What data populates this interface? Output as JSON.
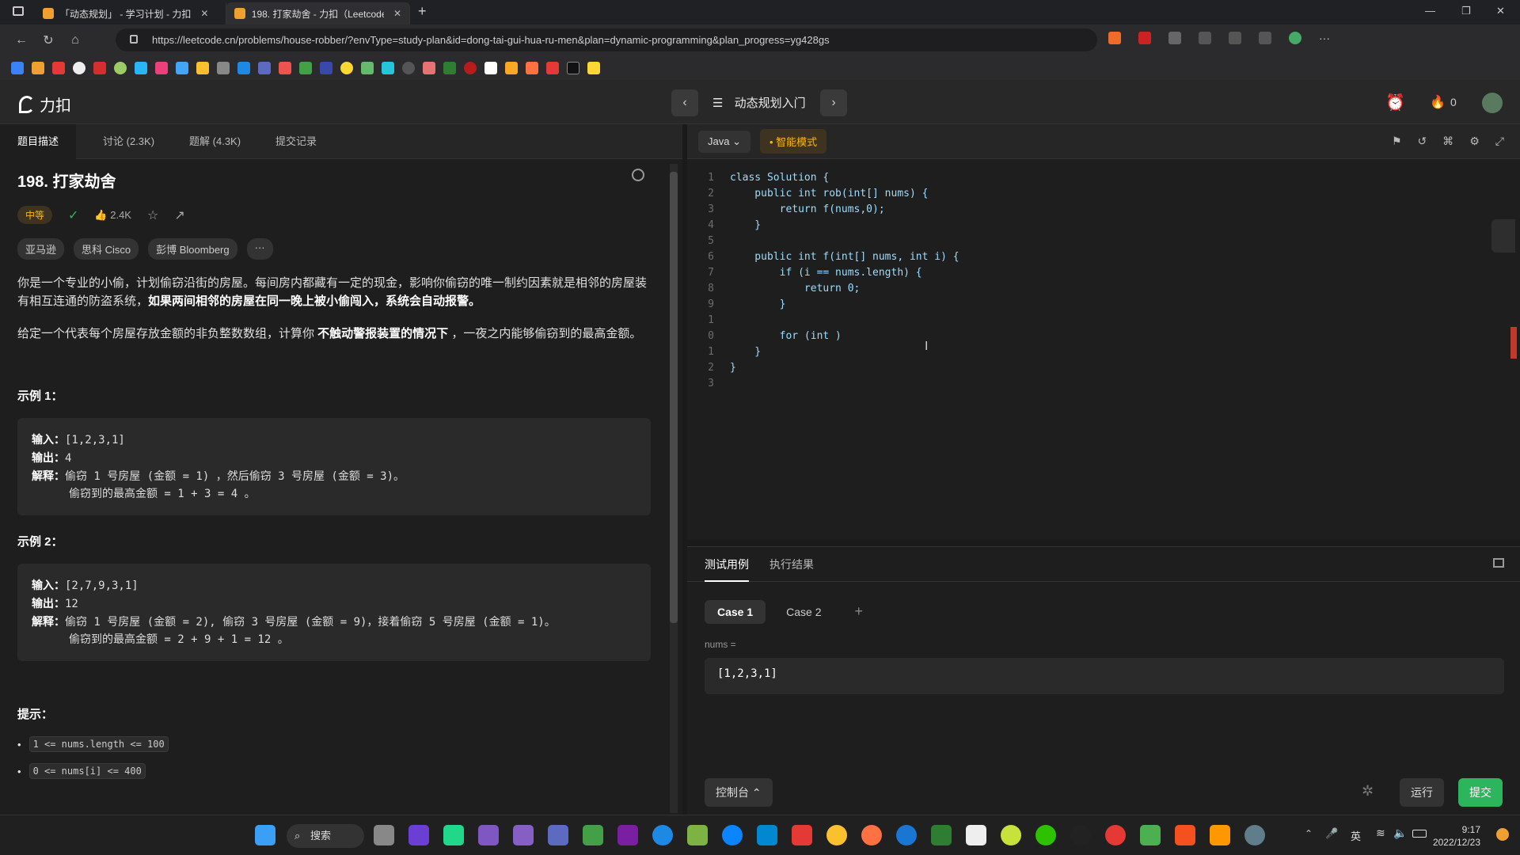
{
  "browser": {
    "tabs": [
      {
        "label": "「动态规划」 - 学习计划 - 力扣",
        "active": false
      },
      {
        "label": "198. 打家劫舍 - 力扣（Leetcode）",
        "active": true
      }
    ],
    "url": "https://leetcode.cn/problems/house-robber/?envType=study-plan&id=dong-tai-gui-hua-ru-men&plan=dynamic-programming&plan_progress=yg428gs"
  },
  "header": {
    "logo_text": "力扣",
    "plan_title": "动态规划入门",
    "streak_count": "0"
  },
  "left_tabs": [
    "题目描述",
    "讨论 (2.3K)",
    "题解 (4.3K)",
    "提交记录"
  ],
  "problem": {
    "title": "198. 打家劫舍",
    "difficulty": "中等",
    "likes": "2.4K",
    "companies": [
      "亚马逊",
      "思科 Cisco",
      "彭博 Bloomberg"
    ],
    "more": "···",
    "desc1_plain": "你是一个专业的小偷，计划偷窃沿街的房屋。每间房内都藏有一定的现金，影响你偷窃的唯一制约因素就是相邻的房屋装有相互连通的防盗系统，",
    "desc1_bold": "如果两间相邻的房屋在同一晚上被小偷闯入，系统会自动报警。",
    "desc2_a": "给定一个代表每个房屋存放金额的非负整数数组，计算你 ",
    "desc2_bold": "不触动警报装置的情况下",
    "desc2_b": " ，一夜之内能够偷窃到的最高金额。",
    "examples": [
      {
        "heading": "示例 1：",
        "input_label": "输入：",
        "input": "[1,2,3,1]",
        "output_label": "输出：",
        "output": "4",
        "explain_label": "解释：",
        "explain1": "偷窃 1 号房屋 (金额 = 1) ，然后偷窃 3 号房屋 (金额 = 3)。",
        "explain2": "偷窃到的最高金额 = 1 + 3 = 4 。"
      },
      {
        "heading": "示例 2：",
        "input_label": "输入：",
        "input": "[2,7,9,3,1]",
        "output_label": "输出：",
        "output": "12",
        "explain_label": "解释：",
        "explain1": "偷窃 1 号房屋 (金额 = 2), 偷窃 3 号房屋 (金额 = 9)，接着偷窃 5 号房屋 (金额 = 1)。",
        "explain2": "偷窃到的最高金额 = 2 + 9 + 1 = 12 。"
      }
    ],
    "hints_heading": "提示：",
    "hints": [
      "1 <= nums.length <= 100",
      "0 <= nums[i] <= 400"
    ]
  },
  "editor": {
    "language": "Java",
    "mode": "智能模式",
    "line_numbers": [
      "1",
      "2",
      "3",
      "4",
      "5",
      "6",
      "7",
      "8",
      "9",
      "1",
      "0",
      "1",
      "2",
      "3"
    ],
    "lines": [
      "class Solution {",
      "    public int rob(int[] nums) {",
      "        return f(nums,0);",
      "    }",
      "",
      "    public int f(int[] nums, int i) {",
      "        if (i == nums.length) {",
      "            return 0;",
      "        }",
      "",
      "        for (int )",
      "    }",
      "}",
      ""
    ]
  },
  "test": {
    "tabs": [
      "测试用例",
      "执行结果"
    ],
    "cases": [
      "Case 1",
      "Case 2"
    ],
    "add": "+",
    "param_label": "nums =",
    "param_value": "[1,2,3,1]",
    "console_label": "控制台",
    "run_label": "运行",
    "submit_label": "提交"
  },
  "taskbar": {
    "search_label": "搜索",
    "ime": "英",
    "time": "9:17",
    "date": "2022/12/23"
  }
}
